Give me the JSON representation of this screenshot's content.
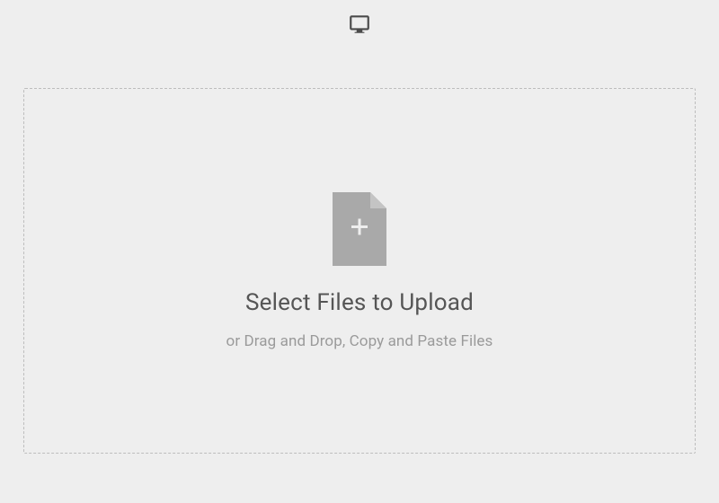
{
  "topbar": {
    "icon_name": "desktop-icon"
  },
  "dropzone": {
    "icon_name": "file-plus-icon",
    "title": "Select Files to Upload",
    "subtitle": "or Drag and Drop, Copy and Paste Files"
  }
}
